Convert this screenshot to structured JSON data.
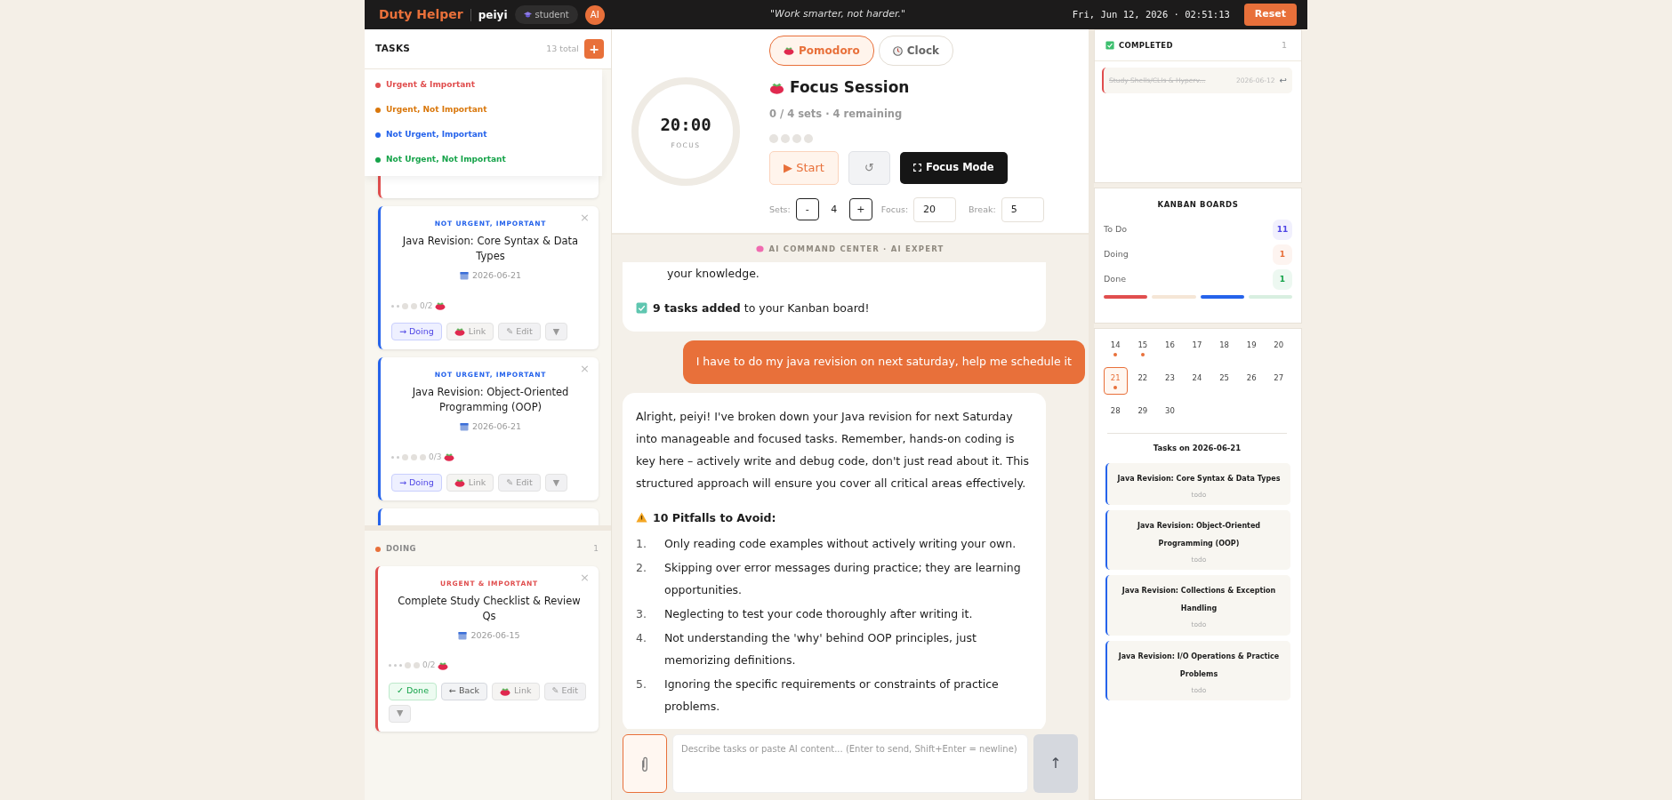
{
  "topbar": {
    "brand": "Duty Helper",
    "user": "peiyi",
    "role": "student",
    "avatar": "AI",
    "quote": "\"Work smarter, not harder.\"",
    "datetime": "Fri, Jun 12, 2026 · 02:51:13",
    "reset": "Reset"
  },
  "tasks_panel": {
    "title": "TASKS",
    "total": "13 total",
    "add": "+",
    "priority_menu": [
      {
        "label": "Urgent & Important",
        "color": "#e04e4e"
      },
      {
        "label": "Urgent, Not Important",
        "color": "#d9770b"
      },
      {
        "label": "Not Urgent, Important",
        "color": "#2563eb"
      },
      {
        "label": "Not Urgent, Not Important",
        "color": "#16a34a"
      }
    ],
    "cards": [
      {
        "kind": "stub",
        "color": "#e04e4e"
      },
      {
        "kind": "full",
        "color": "#2563eb",
        "priority": "NOT URGENT, IMPORTANT",
        "title": "Java Revision: Core Syntax & Data Types",
        "date": "2026-06-21",
        "dots": [
          {
            "kind": "small"
          },
          {
            "kind": "small"
          },
          {
            "kind": "large"
          },
          {
            "kind": "large"
          }
        ],
        "progress": "0/2",
        "close": "×",
        "buttons": [
          {
            "kind": "move",
            "label": "→ Doing"
          },
          {
            "kind": "link",
            "label": "Link"
          },
          {
            "kind": "edit",
            "label": "✎ Edit"
          },
          {
            "kind": "more",
            "label": "▼"
          }
        ]
      },
      {
        "kind": "full",
        "color": "#2563eb",
        "priority": "NOT URGENT, IMPORTANT",
        "title": "Java Revision: Object-Oriented Programming (OOP)",
        "date": "2026-06-21",
        "dots": [
          {
            "kind": "small"
          },
          {
            "kind": "small"
          },
          {
            "kind": "large"
          },
          {
            "kind": "large"
          },
          {
            "kind": "large"
          }
        ],
        "progress": "0/3",
        "close": "×",
        "buttons": [
          {
            "kind": "move",
            "label": "→ Doing"
          },
          {
            "kind": "link",
            "label": "Link"
          },
          {
            "kind": "edit",
            "label": "✎ Edit"
          },
          {
            "kind": "more",
            "label": "▼"
          }
        ]
      },
      {
        "kind": "peek",
        "color": "#2563eb"
      }
    ],
    "doing": {
      "title": "DOING",
      "count": "1",
      "color": "#e8703a",
      "cards": [
        {
          "kind": "full",
          "color": "#e04e4e",
          "priority": "URGENT & IMPORTANT",
          "title": "Complete Study Checklist & Review Qs",
          "date": "2026-06-15",
          "dots": [
            {
              "kind": "small"
            },
            {
              "kind": "small"
            },
            {
              "kind": "small"
            },
            {
              "kind": "large"
            },
            {
              "kind": "large"
            }
          ],
          "progress": "0/2",
          "close": "×",
          "buttons": [
            {
              "kind": "done",
              "label": "✓ Done"
            },
            {
              "kind": "back",
              "label": "← Back"
            },
            {
              "kind": "link",
              "label": "Link"
            },
            {
              "kind": "edit",
              "label": "✎ Edit"
            },
            {
              "kind": "more",
              "label": "▼"
            }
          ]
        }
      ]
    }
  },
  "pomodoro": {
    "modes": [
      {
        "label": "Pomodoro",
        "selected": true,
        "kind": "pomodoro"
      },
      {
        "label": "Clock",
        "selected": false,
        "kind": "clock"
      }
    ],
    "timer": "20:00",
    "timer_label": "FOCUS",
    "title": "Focus Session",
    "summary": "0 / 4 sets · 4 remaining",
    "set_dots": [
      {
        "done": false
      },
      {
        "done": false
      },
      {
        "done": false
      },
      {
        "done": false
      }
    ],
    "start": "▶ Start",
    "reset": "↺",
    "focus_mode": "Focus Mode",
    "sets_label": "Sets:",
    "minus": "-",
    "sets": "4",
    "plus": "+",
    "focus_label": "Focus:",
    "focus_value": "20",
    "break_label": "Break:",
    "break_value": "5"
  },
  "chat": {
    "header": "AI COMMAND CENTER · AI EXPERT",
    "messages": [
      {
        "kind": "ai",
        "blocks": [
          {
            "kind": "para",
            "text": "your knowledge."
          },
          {
            "kind": "note",
            "text": "**9 tasks added** to your Kanban board!"
          }
        ]
      },
      {
        "kind": "user",
        "text": "I have to do my java revision on next saturday, help me schedule it"
      },
      {
        "kind": "ai",
        "blocks": [
          {
            "kind": "para",
            "text": "Alright, peiyi! I've broken down your Java revision for next Saturday into manageable and focused tasks. Remember, hands-on coding is key here – actively write and debug code, don't just read about it. This structured approach will ensure you cover all critical areas effectively."
          },
          {
            "kind": "heading",
            "text": "10 Pitfalls to Avoid:"
          },
          {
            "kind": "list",
            "items": [
              {
                "num": "1.",
                "text": "Only reading code examples without actively writing your own."
              },
              {
                "num": "2.",
                "text": "Skipping over error messages during practice; they are learning opportunities."
              },
              {
                "num": "3.",
                "text": "Neglecting to test your code thoroughly after writing it."
              },
              {
                "num": "4.",
                "text": "Not understanding the 'why' behind OOP principles, just memorizing definitions."
              },
              {
                "num": "5.",
                "text": "Ignoring the specific requirements or constraints of practice problems."
              }
            ]
          }
        ]
      }
    ],
    "input": {
      "placeholder": "Describe tasks or paste AI content... (Enter to send, Shift+Enter = newline)",
      "send": "↑"
    }
  },
  "completed": {
    "title": "COMPLETED",
    "count": "1",
    "items": [
      {
        "title": "Study Shells/CLIs & Hyperv...",
        "date": "2026-06-12",
        "color": "#e04e4e",
        "done": true,
        "undo": "↩"
      }
    ]
  },
  "kanban": {
    "title": "KANBAN BOARDS",
    "boards": [
      {
        "label": "To Do",
        "count": "11",
        "color": "#4f46e5"
      },
      {
        "label": "Doing",
        "count": "1",
        "color": "#e8703a"
      },
      {
        "label": "Done",
        "count": "1",
        "color": "#16a34a"
      }
    ],
    "bars": [
      {
        "color": "#e04e4e"
      },
      {
        "color": "#f5e6d6"
      },
      {
        "color": "#2563eb"
      },
      {
        "color": "#d8efe0"
      }
    ]
  },
  "calendar": {
    "weeks": [
      [
        {
          "day": "14",
          "has_tasks": true,
          "selected": false
        },
        {
          "day": "15",
          "has_tasks": true,
          "selected": false
        },
        {
          "day": "16",
          "has_tasks": false,
          "selected": false
        },
        {
          "day": "17",
          "has_tasks": false,
          "selected": false
        },
        {
          "day": "18",
          "has_tasks": false,
          "selected": false
        },
        {
          "day": "19",
          "has_tasks": false,
          "selected": false
        },
        {
          "day": "20",
          "has_tasks": false,
          "selected": false
        }
      ],
      [
        {
          "day": "21",
          "has_tasks": true,
          "selected": true
        },
        {
          "day": "22",
          "has_tasks": false,
          "selected": false
        },
        {
          "day": "23",
          "has_tasks": false,
          "selected": false
        },
        {
          "day": "24",
          "has_tasks": false,
          "selected": false
        },
        {
          "day": "25",
          "has_tasks": false,
          "selected": false
        },
        {
          "day": "26",
          "has_tasks": false,
          "selected": false
        },
        {
          "day": "27",
          "has_tasks": false,
          "selected": false
        }
      ],
      [
        {
          "day": "28",
          "has_tasks": false,
          "selected": false
        },
        {
          "day": "29",
          "has_tasks": false,
          "selected": false
        },
        {
          "day": "30",
          "has_tasks": false,
          "selected": false
        }
      ]
    ],
    "tasks_title": "Tasks on 2026-06-21",
    "tasks": [
      {
        "title": "Java Revision: Core Syntax & Data Types",
        "status": "todo",
        "color": "#2563eb"
      },
      {
        "title": "Java Revision: Object-Oriented Programming (OOP)",
        "status": "todo",
        "color": "#2563eb"
      },
      {
        "title": "Java Revision: Collections & Exception Handling",
        "status": "todo",
        "color": "#2563eb"
      },
      {
        "title": "Java Revision: I/O Operations & Practice Problems",
        "status": "todo",
        "color": "#2563eb"
      }
    ]
  }
}
